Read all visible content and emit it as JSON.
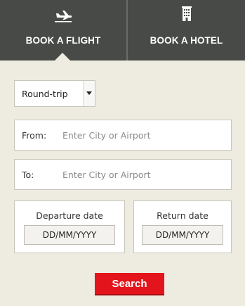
{
  "tabs": {
    "flight": {
      "label": "BOOK A FLIGHT",
      "icon": "airplane-icon",
      "active": true
    },
    "hotel": {
      "label": "BOOK A HOTEL",
      "icon": "hotel-building-icon",
      "active": false
    }
  },
  "form": {
    "trip_type": {
      "selected": "Round-trip"
    },
    "from": {
      "label": "From:",
      "placeholder": "Enter City or Airport"
    },
    "to": {
      "label": "To:",
      "placeholder": "Enter City or Airport"
    },
    "departure": {
      "title": "Departure date",
      "value": "DD/MM/YYYY"
    },
    "return": {
      "title": "Return date",
      "value": "DD/MM/YYYY"
    },
    "search_label": "Search"
  },
  "colors": {
    "tab_bar": "#484a47",
    "background": "#eeebe1",
    "search_button": "#e3141b"
  }
}
